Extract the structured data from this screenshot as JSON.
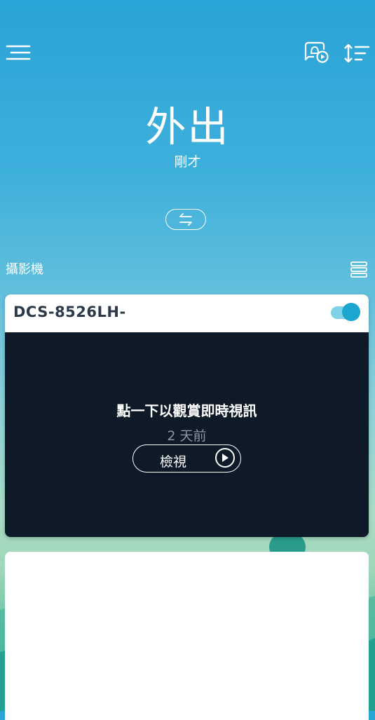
{
  "header": {
    "mode_title": "外出",
    "mode_subtitle": "剛才"
  },
  "icons": {
    "menu": "hamburger-menu-icon",
    "event_playback": "bell-playback-icon",
    "sort": "sort-icon",
    "switch_mode": "swap-arrows-icon",
    "list_view": "list-view-icon",
    "play": "play-icon"
  },
  "cameras_section": {
    "label": "攝影機"
  },
  "camera_card": {
    "name": "DCS-8526LH-",
    "enabled": true,
    "live_prompt": "點一下以觀賞即時視訊",
    "time_ago": "2 天前",
    "view_label": "檢視"
  },
  "colors": {
    "accent": "#1aa6cf",
    "card_body": "#0e1a28",
    "sky_top": "#2aa3d6"
  }
}
